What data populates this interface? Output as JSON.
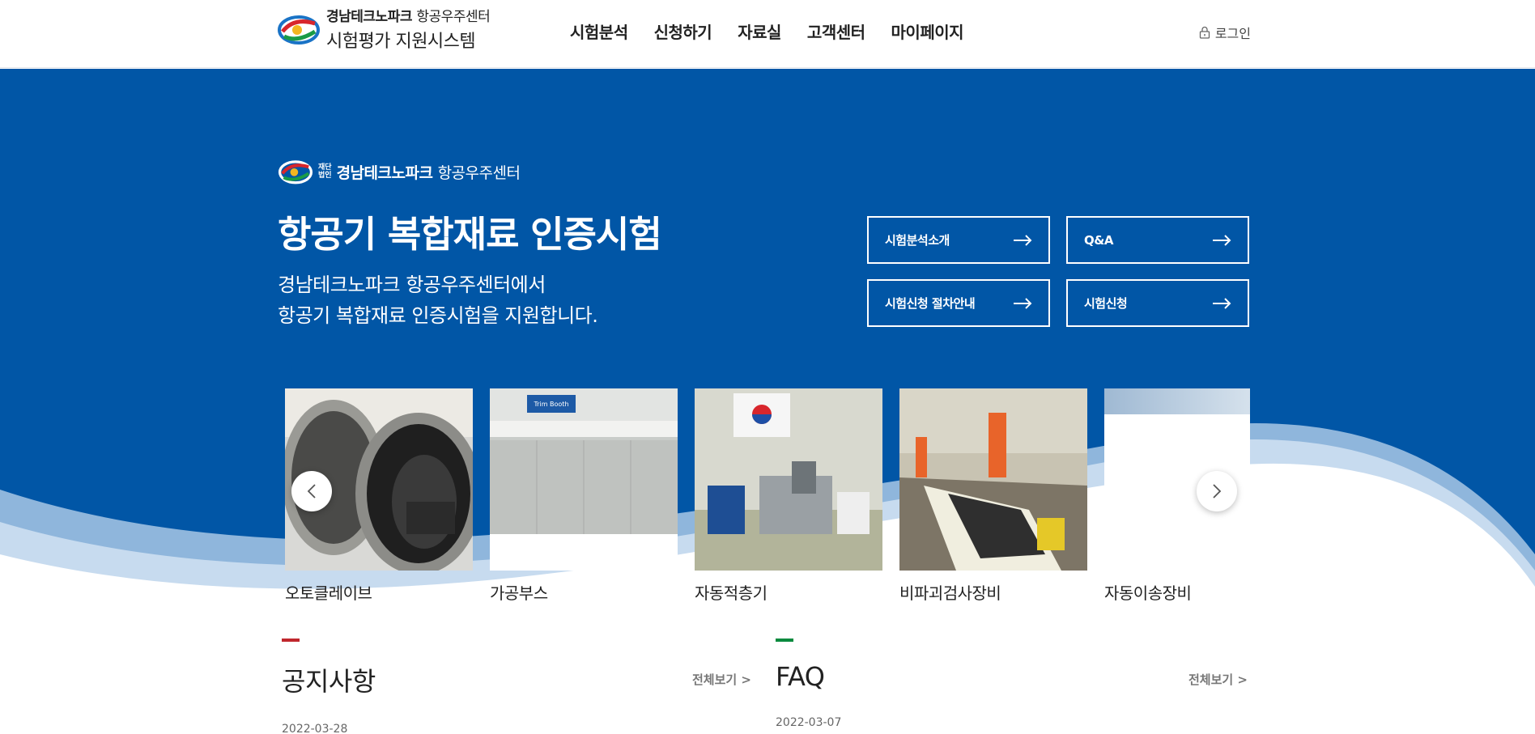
{
  "header": {
    "logo_bold": "경남테크노파크",
    "logo_light": "항공우주센터",
    "logo_sub": "시험평가 지원시스템",
    "nav": [
      "시험분석",
      "신청하기",
      "자료실",
      "고객센터",
      "마이페이지"
    ],
    "login_label": "로그인"
  },
  "hero": {
    "org_small_1": "재단",
    "org_small_2": "법인",
    "org_bold": "경남테크노파크",
    "org_light": "항공우주센터",
    "title": "항공기 복합재료 인증시험",
    "desc_line1": "경남테크노파크 항공우주센터에서",
    "desc_line2": "항공기 복합재료 인증시험을 지원합니다.",
    "buttons": [
      "시험분석소개",
      "Q&A",
      "시험신청 절차안내",
      "시험신청"
    ]
  },
  "carousel": {
    "items": [
      "오토클레이브",
      "가공부스",
      "자동적층기",
      "비파괴검사장비",
      "자동이송장비"
    ],
    "booth_sign": "Trim Booth"
  },
  "notice": {
    "title": "공지사항",
    "more": "전체보기 >",
    "date": "2022-03-28"
  },
  "faq": {
    "title": "FAQ",
    "more": "전체보기 >",
    "date": "2022-03-07"
  },
  "colors": {
    "primary": "#0156a6",
    "notice_bar": "#c0272d",
    "faq_bar": "#0a8a3e"
  }
}
